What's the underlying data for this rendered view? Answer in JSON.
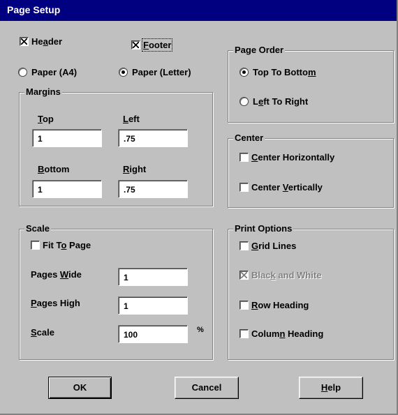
{
  "window": {
    "title": "Page Setup"
  },
  "header_check": {
    "pre": "He",
    "key": "a",
    "post": "der",
    "checked": true
  },
  "footer_check": {
    "pre": "",
    "key": "F",
    "post": "ooter",
    "checked": true
  },
  "paper": {
    "a4": {
      "label": "Paper (A4)",
      "selected": false
    },
    "letter": {
      "label": "Paper (Letter)",
      "selected": true
    }
  },
  "margins": {
    "title": "Margins",
    "top": {
      "key": "T",
      "rest": "op",
      "value": "1"
    },
    "left": {
      "key": "L",
      "rest": "eft",
      "value": ".75"
    },
    "bottom": {
      "key": "B",
      "rest": "ottom",
      "value": "1"
    },
    "right": {
      "key": "R",
      "rest": "ight",
      "value": ".75"
    }
  },
  "page_order": {
    "title": "Page Order",
    "top_to_bottom": {
      "pre": "Top To Botto",
      "key": "m",
      "post": "",
      "selected": true
    },
    "left_to_right": {
      "pre": "L",
      "key": "e",
      "post": "ft To Right",
      "selected": false
    }
  },
  "center": {
    "title": "Center",
    "horizontally": {
      "pre": "",
      "key": "C",
      "post": "enter Horizontally",
      "checked": false
    },
    "vertically": {
      "pre": "Center ",
      "key": "V",
      "post": "ertically",
      "checked": false
    }
  },
  "scale_group": {
    "title": "Scale",
    "fit_to_page": {
      "pre": "Fit T",
      "key": "o",
      "post": " Page",
      "checked": false
    },
    "pages_wide": {
      "pre": "Pages ",
      "key": "W",
      "post": "ide",
      "value": "1"
    },
    "pages_high": {
      "pre": "",
      "key": "P",
      "post": "ages High",
      "value": "1"
    },
    "scale": {
      "pre": "",
      "key": "S",
      "post": "cale",
      "value": "100",
      "unit": "%"
    }
  },
  "print_options": {
    "title": "Print Options",
    "grid_lines": {
      "pre": "",
      "key": "G",
      "post": "rid Lines",
      "checked": false,
      "enabled": true
    },
    "black_white": {
      "pre": "Blac",
      "key": "k",
      "post": " and White",
      "checked": true,
      "enabled": false
    },
    "row_heading": {
      "pre": "",
      "key": "R",
      "post": "ow Heading",
      "checked": false,
      "enabled": true
    },
    "column_heading": {
      "pre": "Colum",
      "key": "n",
      "post": " Heading",
      "checked": false,
      "enabled": true
    }
  },
  "buttons": {
    "ok": "OK",
    "cancel": "Cancel",
    "help": {
      "pre": "",
      "key": "H",
      "post": "elp"
    }
  }
}
